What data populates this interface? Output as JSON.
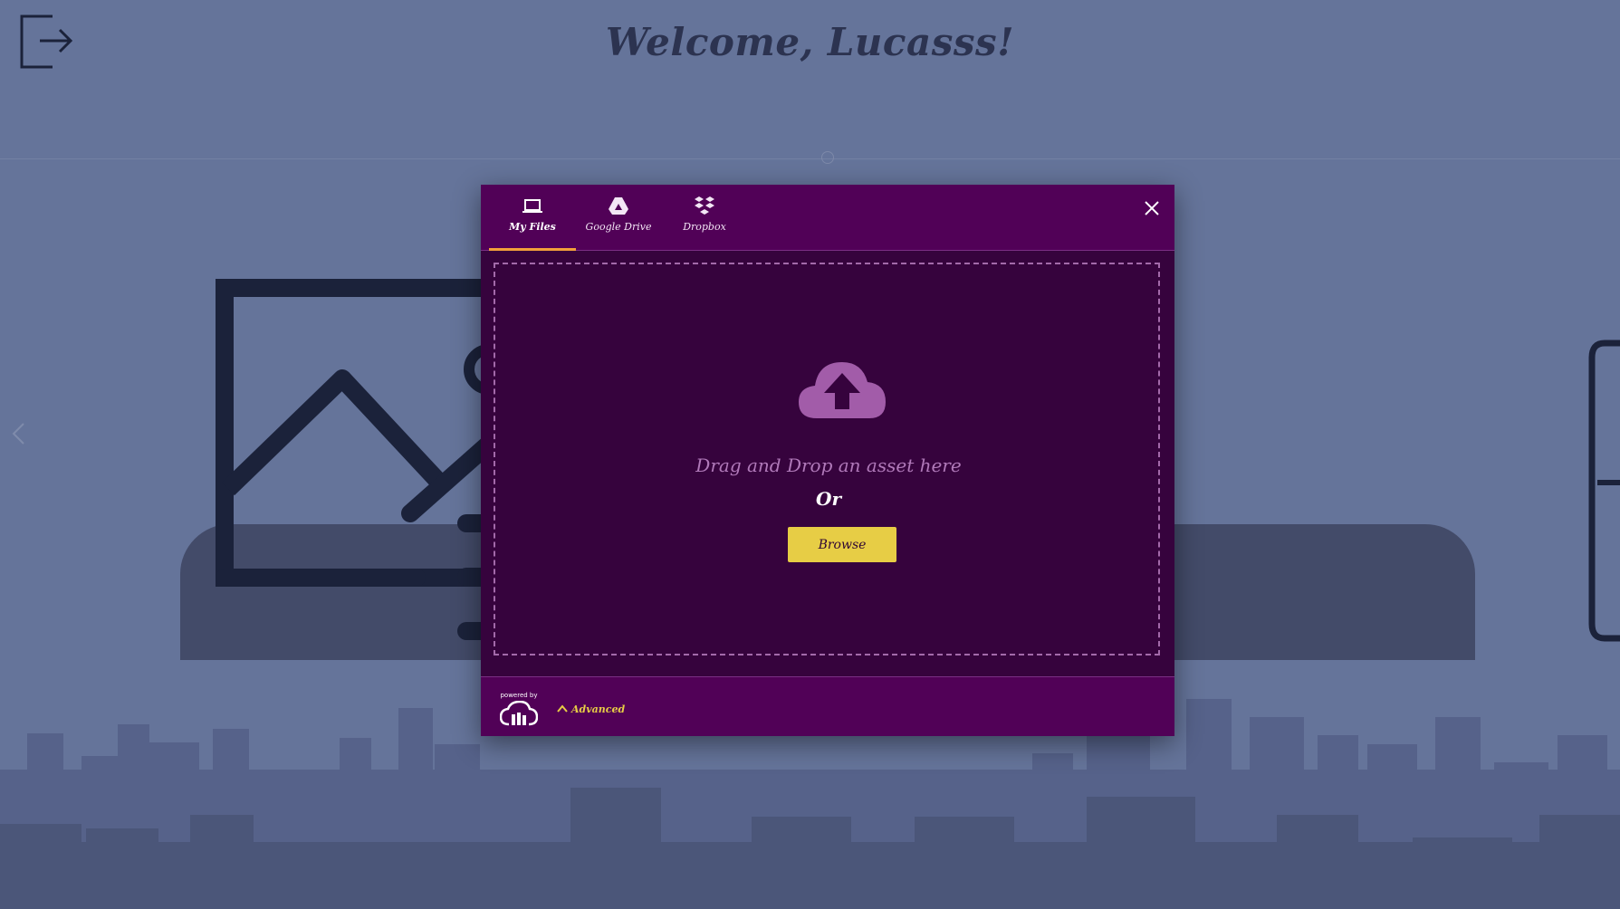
{
  "header": {
    "welcome_text": "Welcome, Lucasss!",
    "logout_icon": "logout-icon"
  },
  "colors": {
    "background": "#65749a",
    "modal_header": "#510157",
    "drop_area": "#36033d",
    "accent_yellow": "#e7cd45",
    "active_tab_underline": "#f2a13a"
  },
  "modal": {
    "tabs": [
      {
        "label": "My Files",
        "icon": "laptop-icon",
        "active": true
      },
      {
        "label": "Google Drive",
        "icon": "google-drive-icon",
        "active": false
      },
      {
        "label": "Dropbox",
        "icon": "dropbox-icon",
        "active": false
      }
    ],
    "close_icon": "close-icon",
    "drop_text": "Drag and Drop an asset here",
    "or_text": "Or",
    "browse_label": "Browse",
    "footer": {
      "powered_by": "powered by",
      "advanced_label": "Advanced"
    }
  }
}
